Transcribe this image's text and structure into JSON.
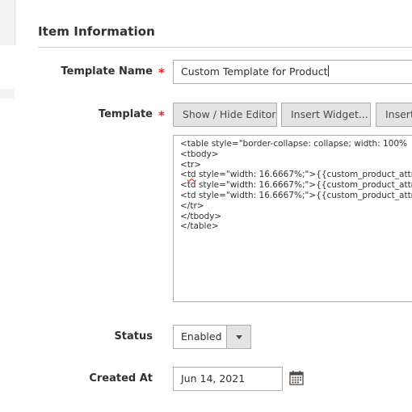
{
  "section": {
    "title": "Item Information"
  },
  "fields": {
    "template_name": {
      "label": "Template Name",
      "required_mark": "*",
      "value": "Custom Template for Product"
    },
    "template": {
      "label": "Template",
      "required_mark": "*",
      "buttons": {
        "show_hide_editor": "Show / Hide Editor",
        "insert_widget": "Insert Widget...",
        "insert_variable": "Insert"
      },
      "editor_lines": [
        "<table style=\"border-collapse: collapse; width: 100%",
        "<tbody>",
        "<tr>",
        "style=\"width: 16.6667%;\">{{custom_product_attr",
        "<td style=\"width: 16.6667%;\">{{custom_product_attr",
        "<td style=\"width: 16.6667%;\">{{custom_product_attr",
        "</tr>",
        "</tbody>",
        "</table>"
      ],
      "editor_line4_prefix_open": "<",
      "editor_line4_tag": "td"
    },
    "status": {
      "label": "Status",
      "value": "Enabled"
    },
    "created_at": {
      "label": "Created At",
      "value": "Jun 14, 2021"
    }
  },
  "colors": {
    "required": "#e22626",
    "button_bg": "#e3e3e3",
    "border": "#adadad",
    "text": "#303030"
  },
  "icons": {
    "select_arrow": "chevron-down-icon",
    "calendar": "calendar-icon"
  }
}
